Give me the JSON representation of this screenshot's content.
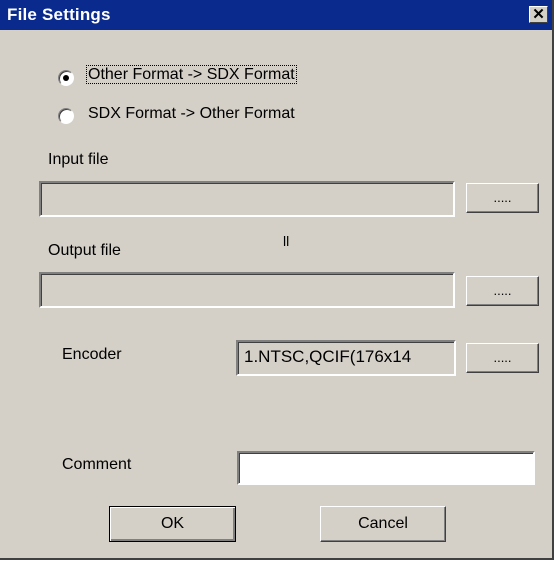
{
  "window": {
    "title": "File Settings",
    "close_glyph": "✕"
  },
  "conversion": {
    "options": [
      {
        "label": "Other Format -> SDX Format",
        "selected": true
      },
      {
        "label": "SDX Format -> Other Format",
        "selected": false
      }
    ]
  },
  "input_file": {
    "label": "Input file",
    "value": "",
    "browse_label": "....."
  },
  "separator_mark": "ll",
  "output_file": {
    "label": "Output file",
    "value": "",
    "browse_label": "....."
  },
  "encoder": {
    "label": "Encoder",
    "value": "1.NTSC,QCIF(176x14",
    "browse_label": "....."
  },
  "comment": {
    "label": "Comment",
    "value": ""
  },
  "buttons": {
    "ok": "OK",
    "cancel": "Cancel"
  },
  "colors": {
    "titlebar": "#0a2a8e",
    "dialog_face": "#d4d0c8",
    "title_text": "#ffffff"
  }
}
